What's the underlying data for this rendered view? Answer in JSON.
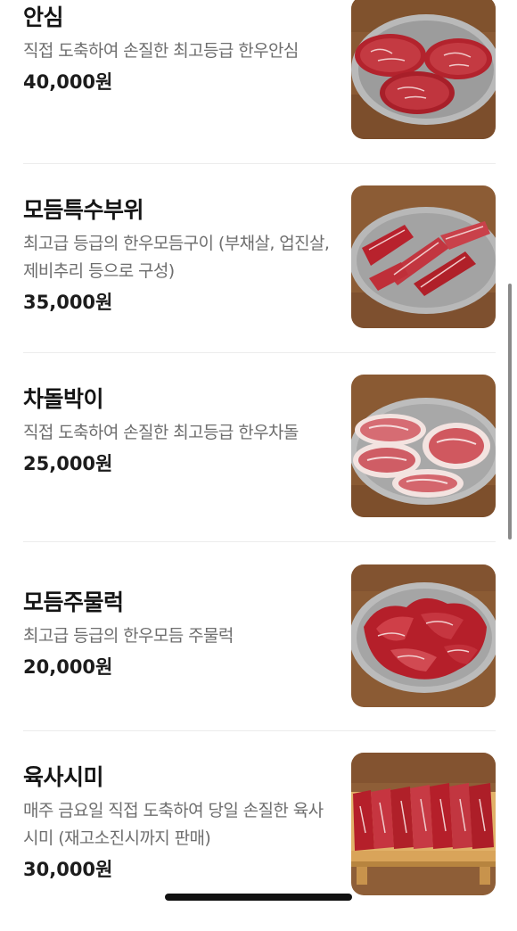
{
  "menu": {
    "items": [
      {
        "name": "안심",
        "description": "직접 도축하여 손질한 최고등급 한우안심",
        "price": "40,000원",
        "image_icon": "tenderloin-steak-photo"
      },
      {
        "name": "모듬특수부위",
        "description": "최고급 등급의 한우모듬구이 (부채살, 업진살, 제비추리 등으로 구성)",
        "price": "35,000원",
        "image_icon": "special-cuts-photo"
      },
      {
        "name": "차돌박이",
        "description": "직접 도축하여 손질한 최고등급 한우차돌",
        "price": "25,000원",
        "image_icon": "brisket-slices-photo"
      },
      {
        "name": "모듬주물럭",
        "description": "최고급 등급의 한우모듬 주물럭",
        "price": "20,000원",
        "image_icon": "marinated-beef-photo"
      },
      {
        "name": "육사시미",
        "description": "매주 금요일 직접 도축하여 당일 손질한 육사시미 (재고소진시까지 판매)",
        "price": "30,000원",
        "image_icon": "beef-sashimi-photo"
      }
    ]
  },
  "colors": {
    "background": "#ffffff",
    "name_text": "#151515",
    "description_text": "#6e6e6e",
    "price_text": "#1c1c1c",
    "divider": "#ececec",
    "wood": "#8a5a34"
  }
}
